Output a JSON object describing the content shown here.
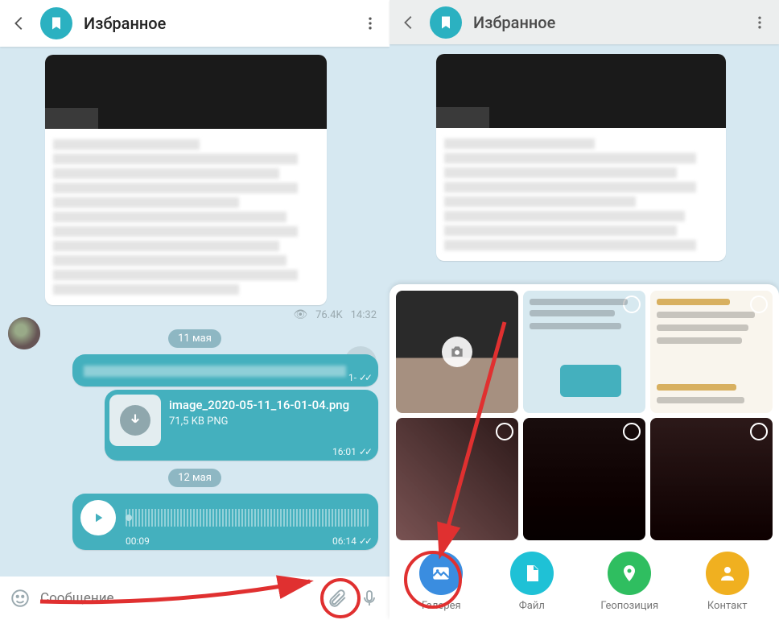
{
  "left": {
    "title": "Избранное",
    "view_count": "76.4K",
    "view_time": "14:32",
    "date1": "11 мая",
    "msg1_time": "1-",
    "file_name": "image_2020-05-11_16-01-04.png",
    "file_meta": "71,5 KB PNG",
    "file_time": "16:01",
    "date2": "12 мая",
    "voice_pos": "00:09",
    "voice_time": "06:14",
    "placeholder": "Сообщение"
  },
  "right": {
    "title": "Избранное",
    "actions": {
      "gallery": "Галерея",
      "file": "Файл",
      "location": "Геопозиция",
      "contact": "Контакт"
    }
  }
}
